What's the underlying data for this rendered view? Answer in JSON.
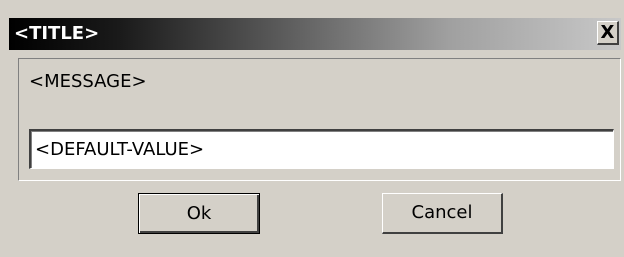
{
  "dialog": {
    "title": "<TITLE>",
    "close_label": "X",
    "message": "<MESSAGE>",
    "input": {
      "value": "<DEFAULT-VALUE>",
      "placeholder": ""
    },
    "buttons": {
      "ok_label": "Ok",
      "cancel_label": "Cancel"
    }
  },
  "colors": {
    "face": "#d4d0c8",
    "title_gradient_start": "#000000",
    "title_gradient_end": "#c8c8c8",
    "title_text": "#ffffff",
    "input_background": "#ffffff"
  },
  "icons": {
    "close": "close-icon"
  }
}
